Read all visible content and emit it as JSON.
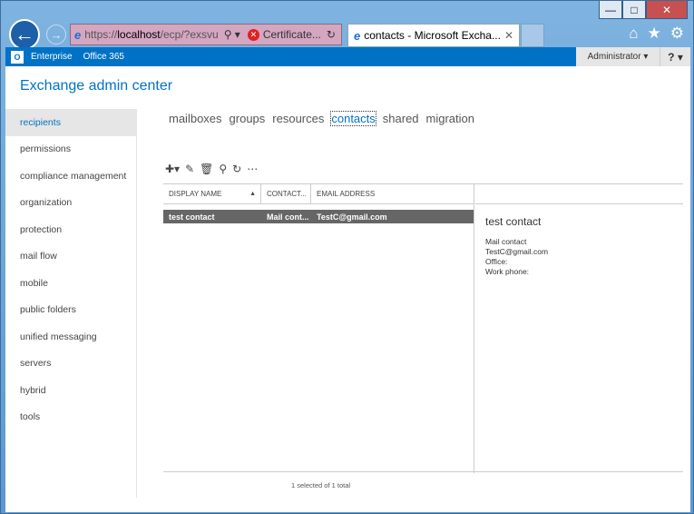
{
  "browser": {
    "url_prefix": "https://",
    "url_host": "localhost",
    "url_path": "/ecp/?exsvu",
    "cert_label": "Certificate...",
    "tab_title": "contacts - Microsoft Excha...",
    "icons": [
      "back-arrow-icon",
      "forward-arrow-icon",
      "home-icon",
      "favorites-star-icon",
      "tools-gear-icon"
    ]
  },
  "topbar": {
    "links": [
      "Enterprise",
      "Office 365"
    ],
    "user": "Administrator",
    "help": "?"
  },
  "app_title": "Exchange admin center",
  "sidebar": {
    "items": [
      "recipients",
      "permissions",
      "compliance management",
      "organization",
      "protection",
      "mail flow",
      "mobile",
      "public folders",
      "unified messaging",
      "servers",
      "hybrid",
      "tools"
    ],
    "active": "recipients"
  },
  "tabs": {
    "items": [
      "mailboxes",
      "groups",
      "resources",
      "contacts",
      "shared",
      "migration"
    ],
    "active": "contacts"
  },
  "table": {
    "headers": [
      "DISPLAY NAME",
      "CONTACT...",
      "EMAIL ADDRESS"
    ],
    "rows": [
      {
        "name": "test contact",
        "type": "Mail cont...",
        "email": "TestC@gmail.com"
      }
    ]
  },
  "details": {
    "name": "test contact",
    "lines": [
      "Mail contact",
      "TestC@gmail.com",
      "Office:",
      "Work phone:"
    ]
  },
  "status": "1 selected of 1 total",
  "colors": {
    "accent": "#0072c6",
    "selected_row": "#666666"
  }
}
